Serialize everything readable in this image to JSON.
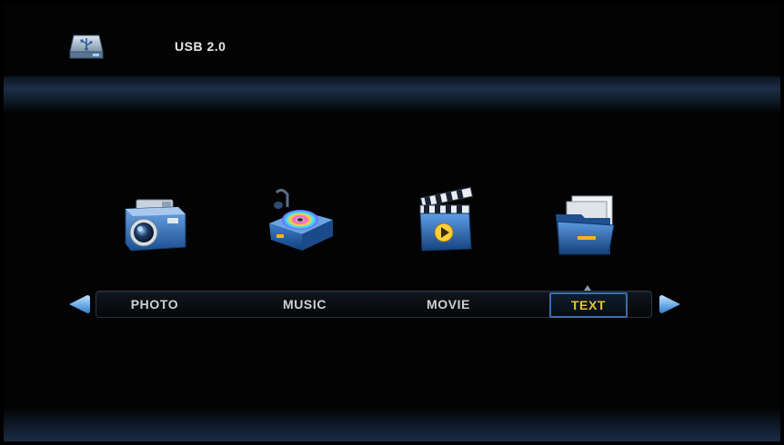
{
  "header": {
    "device_label": "USB 2.0",
    "device_icon": "usb-drive-icon"
  },
  "menu": {
    "items": [
      {
        "label": "PHOTO",
        "icon": "camera-icon"
      },
      {
        "label": "MUSIC",
        "icon": "music-disc-icon"
      },
      {
        "label": "MOVIE",
        "icon": "clapperboard-icon"
      },
      {
        "label": "TEXT",
        "icon": "document-folder-icon"
      }
    ],
    "selected": "TEXT",
    "selected_color": "#e6c430",
    "highlight_color": "#3a6ea8"
  },
  "nav": {
    "left_icon": "arrow-left-icon",
    "right_icon": "arrow-right-icon"
  }
}
